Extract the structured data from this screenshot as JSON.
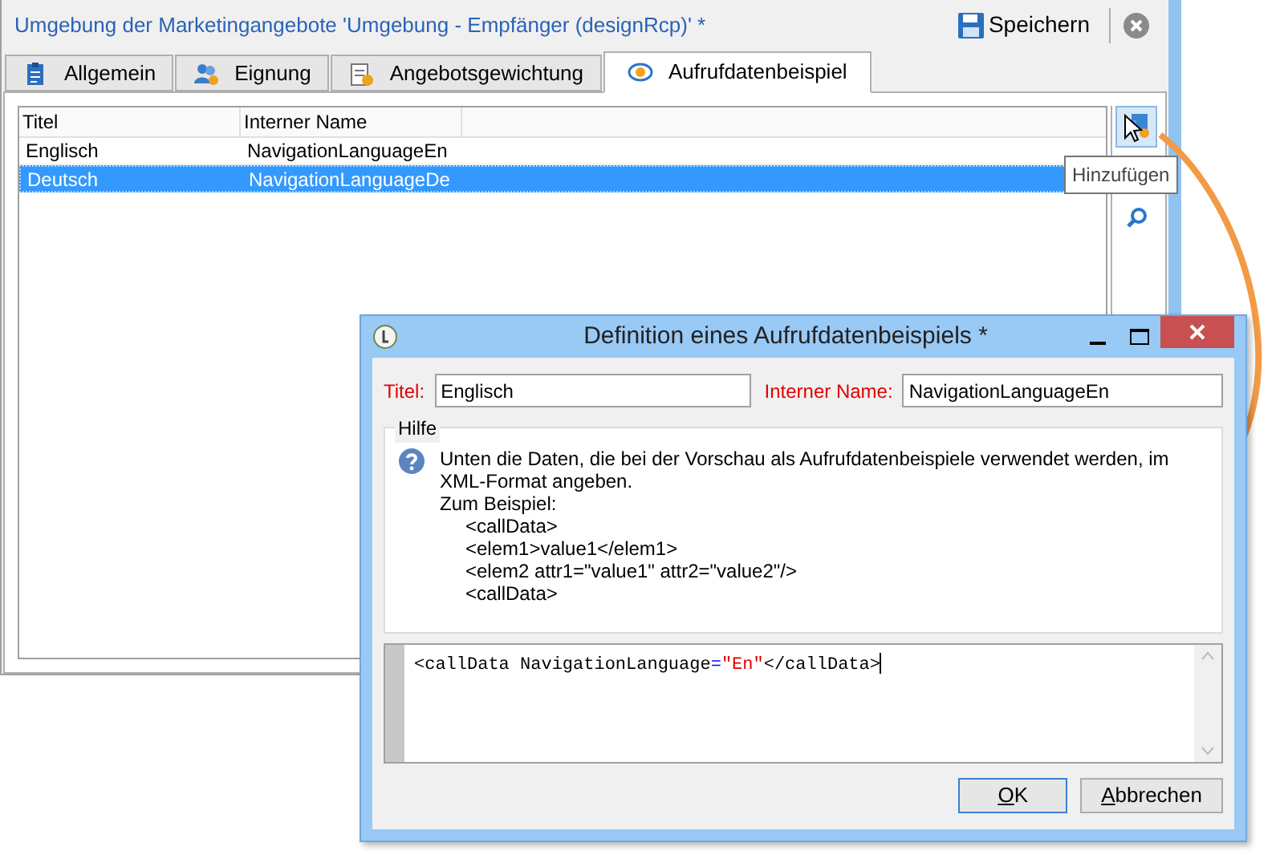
{
  "window": {
    "title": "Umgebung der Marketingangebote 'Umgebung - Empfänger (designRcp)' *",
    "save_button": "Speichern"
  },
  "tabs": [
    {
      "label": "Allgemein",
      "selected": false
    },
    {
      "label": "Eignung",
      "selected": false
    },
    {
      "label": "Angebotsgewichtung",
      "selected": false
    },
    {
      "label": "Aufrufdatenbeispiel",
      "selected": true
    }
  ],
  "list": {
    "columns": [
      "Titel",
      "Interner Name"
    ],
    "rows": [
      {
        "cells": [
          "Englisch",
          "NavigationLanguageEn"
        ],
        "selected": false
      },
      {
        "cells": [
          "Deutsch",
          "NavigationLanguageDe"
        ],
        "selected": true
      }
    ]
  },
  "tooltip": "Hinzufügen",
  "dialog": {
    "title": "Definition eines Aufrufdatenbeispiels *",
    "fields": [
      {
        "label": "Titel:",
        "value": "Englisch"
      },
      {
        "label": "Interner Name:",
        "value": "NavigationLanguageEn"
      }
    ],
    "help": {
      "title": "Hilfe",
      "text": "Unten die Daten, die bei der Vorschau als Aufrufdatenbeispiele verwendet werden, im XML-Format angeben.",
      "example_label": "Zum Beispiel:",
      "example": [
        "<callData>",
        "<elem1>value1</elem1>",
        "<elem2 attr1=\"value1\" attr2=\"value2\"/>",
        "<callData>"
      ]
    },
    "code": [
      {
        "text": "<callData NavigationLanguage",
        "kind": "plain"
      },
      {
        "text": "=",
        "kind": "operator"
      },
      {
        "text": "\"En\"",
        "kind": "string"
      },
      {
        "text": "</callData>",
        "kind": "plain"
      }
    ],
    "buttons": [
      {
        "label": "OK",
        "default": true
      },
      {
        "label": "Abbrechen",
        "default": false
      }
    ]
  }
}
